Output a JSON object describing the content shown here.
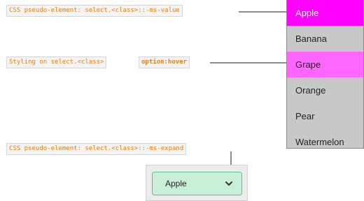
{
  "annotations": {
    "ms_value": "CSS pseudo-element: select.<class>::-ms-value",
    "hover_prefix": "Styling on select.<class>",
    "hover_suffix": "option:hover",
    "ms_expand": "CSS pseudo-element: select.<class>::-ms-expand"
  },
  "dropdown": {
    "options": [
      "Apple",
      "Banana",
      "Grape",
      "Orange",
      "Pear",
      "Watermelon"
    ],
    "selected_index": 0,
    "hover_index": 2
  },
  "select": {
    "value": "Apple",
    "expand_icon": "chevron-down-icon"
  },
  "colors": {
    "selected_bg": "#ff00ff",
    "hover_bg": "#ff66ff",
    "list_bg": "#c8c8c8",
    "select_bg": "#c8f0d8",
    "select_border": "#5cc08a",
    "code_text": "#e87d0d"
  }
}
